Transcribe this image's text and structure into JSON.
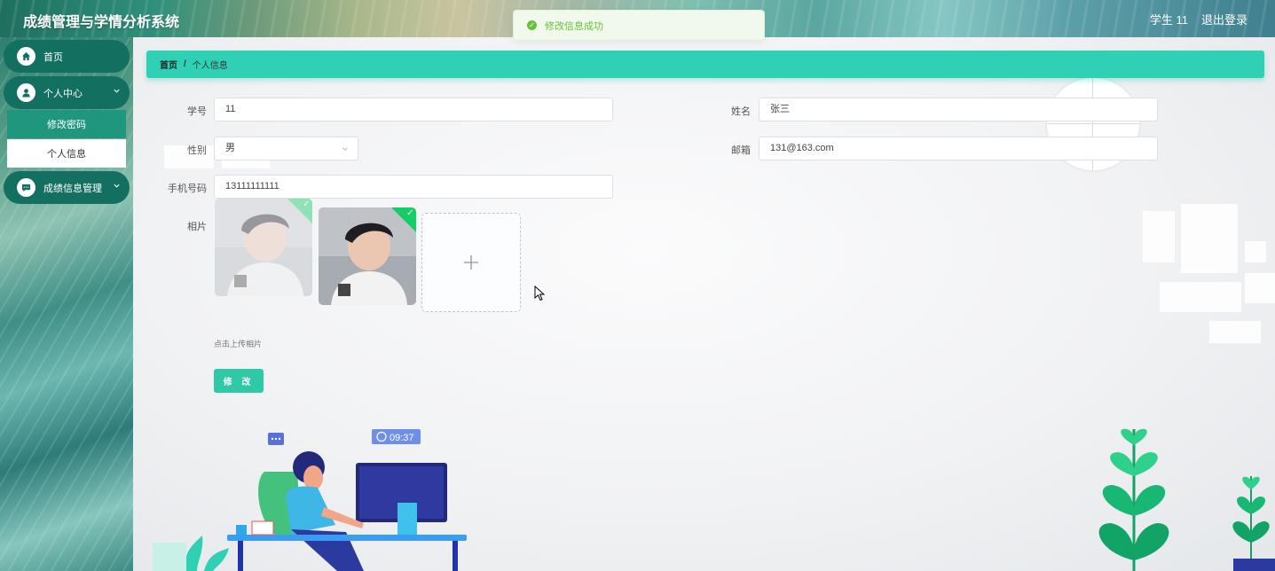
{
  "header": {
    "title": "成绩管理与学情分析系统",
    "user": "学生 11",
    "logout": "退出登录"
  },
  "toast": {
    "message": "修改信息成功"
  },
  "sidebar": {
    "items": [
      {
        "label": "首页",
        "icon": "home-icon"
      },
      {
        "label": "个人中心",
        "icon": "user-icon"
      },
      {
        "label": "成绩信息管理",
        "icon": "chat-icon"
      }
    ],
    "submenu": [
      {
        "label": "修改密码",
        "active": true
      },
      {
        "label": "个人信息",
        "active": false
      }
    ]
  },
  "breadcrumb": {
    "home": "首页",
    "separator": "/",
    "current": "个人信息"
  },
  "form": {
    "student_id_label": "学号",
    "student_id": "11",
    "name_label": "姓名",
    "name": "张三",
    "gender_label": "性别",
    "gender": "男",
    "email_label": "邮箱",
    "email": "131@163.com",
    "phone_label": "手机号码",
    "phone": "13111111111",
    "photo_label": "相片",
    "upload_tip": "点击上传相片",
    "submit_label": "修 改"
  },
  "illustration": {
    "clock_time": "09:37"
  },
  "colors": {
    "accent": "#2fd0b3",
    "menu": "#137060",
    "submenu_active": "#21967f",
    "success": "#67c23a"
  }
}
